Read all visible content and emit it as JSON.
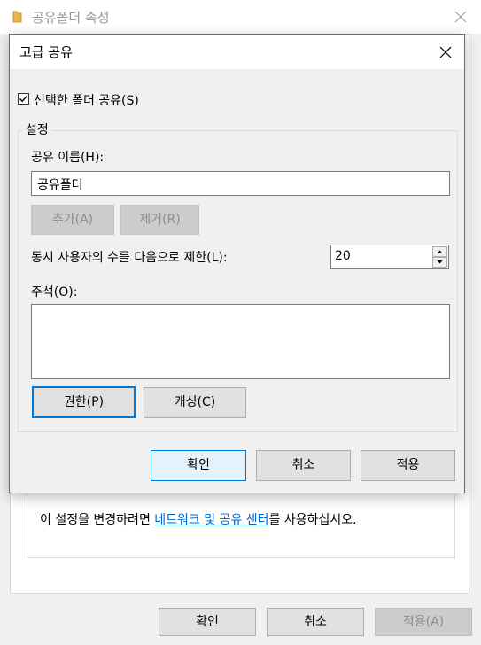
{
  "parent_window": {
    "title": "공유폴더 속성",
    "info_prefix": "이 설정을 변경하려면 ",
    "info_link": "네트워크 및 공유 센터",
    "info_suffix": "를 사용하십시오.",
    "ok_label": "확인",
    "cancel_label": "취소",
    "apply_label": "적용(A)"
  },
  "dialog": {
    "title": "고급 공유",
    "share_checkbox": {
      "label": "선택한 폴더 공유(S)",
      "checked": true
    },
    "settings_group": {
      "legend": "설정",
      "share_name_label": "공유 이름(H):",
      "share_name_value": "공유폴더",
      "add_label": "추가(A)",
      "remove_label": "제거(R)",
      "limit_label": "동시 사용자의 수를 다음으로 제한(L):",
      "limit_value": "20",
      "comment_label": "주석(O):",
      "comment_value": "",
      "permissions_label": "권한(P)",
      "caching_label": "캐싱(C)"
    },
    "ok_label": "확인",
    "cancel_label": "취소",
    "apply_label": "적용"
  },
  "colors": {
    "accent": "#0078d7",
    "link": "#0066cc",
    "folder_icon": "#e8b64a"
  },
  "icons": [
    "folder-icon",
    "close-icon",
    "checkmark-icon",
    "spin-up-icon",
    "spin-down-icon"
  ]
}
